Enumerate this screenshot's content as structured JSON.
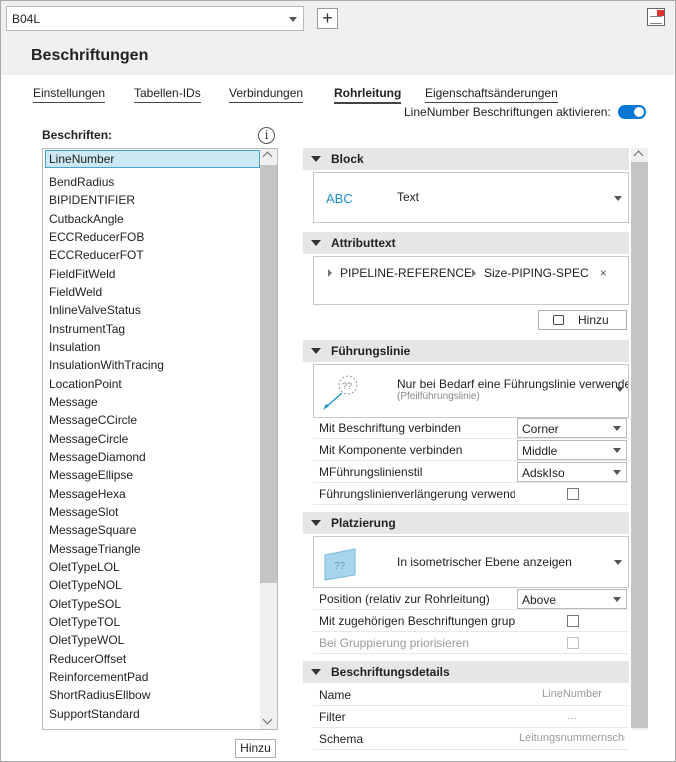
{
  "toolbar": {
    "style_value": "B04L",
    "add_symbol": "+"
  },
  "page_title": "Beschriftungen",
  "tabs": [
    {
      "label": "Einstellungen"
    },
    {
      "label": "Tabellen-IDs"
    },
    {
      "label": "Verbindungen"
    },
    {
      "label": "Rohrleitung"
    },
    {
      "label": "Eigenschaftsänderungen"
    }
  ],
  "toggle": {
    "label": "LineNumber Beschriftungen aktivieren:",
    "on": true
  },
  "labels_panel": {
    "title": "Beschriften:",
    "info_symbol": "i",
    "items": [
      "LineNumber",
      "BendRadius",
      "BIPIDENTIFIER",
      "CutbackAngle",
      "ECCReducerFOB",
      "ECCReducerFOT",
      "FieldFitWeld",
      "FieldWeld",
      "InlineValveStatus",
      "InstrumentTag",
      "Insulation",
      "InsulationWithTracing",
      "LocationPoint",
      "Message",
      "MessageCCircle",
      "MessageCircle",
      "MessageDiamond",
      "MessageEllipse",
      "MessageHexa",
      "MessageSlot",
      "MessageSquare",
      "MessageTriangle",
      "OletTypeLOL",
      "OletTypeNOL",
      "OletTypeSOL",
      "OletTypeTOL",
      "OletTypeWOL",
      "ReducerOffset",
      "ReinforcementPad",
      "ShortRadiusEllbow",
      "SupportStandard"
    ],
    "selected": "LineNumber",
    "add_button": "Hinzu"
  },
  "sections": {
    "block": {
      "title": "Block",
      "icon_text": "ABC",
      "value": "Text"
    },
    "attribute_text": {
      "title": "Attributtext",
      "chips": [
        "PIPELINE-REFERENCE-",
        "Size-PIPING-SPEC"
      ],
      "remove_symbol": "×",
      "add_button": "Hinzu"
    },
    "leader": {
      "title": "Führungslinie",
      "option_title": "Nur bei Bedarf eine Führungslinie verwenden",
      "option_sub": "(Pfeilführungslinie)",
      "icon_text": "??",
      "rows": [
        {
          "label": "Mit Beschriftung verbinden",
          "value": "Corner"
        },
        {
          "label": "Mit Komponente verbinden",
          "value": "Middle"
        },
        {
          "label": "MFührungslinienstil",
          "value": "AdskIso"
        },
        {
          "label": "Führungslinienverlängerung verwenden",
          "checked": false
        }
      ]
    },
    "placement": {
      "title": "Platzierung",
      "icon_text": "??",
      "option_title": "In isometrischer Ebene anzeigen",
      "rows": [
        {
          "label": "Position (relativ zur Rohrleitung)",
          "value": "Above"
        },
        {
          "label": "Mit zugehörigen Beschriftungen gruppieren",
          "checked": false
        },
        {
          "label": "Bei Gruppierung priorisieren",
          "checked": false,
          "disabled": true
        }
      ]
    },
    "details": {
      "title": "Beschriftungsdetails",
      "rows": [
        {
          "label": "Name",
          "value": "LineNumber"
        },
        {
          "label": "Filter",
          "value": "..."
        },
        {
          "label": "Schema",
          "value": "Leitungsnummernschema"
        }
      ]
    }
  },
  "colors": {
    "accent": "#0078d4",
    "selection": "#cce8f4",
    "abc": "#1a8fd1"
  }
}
